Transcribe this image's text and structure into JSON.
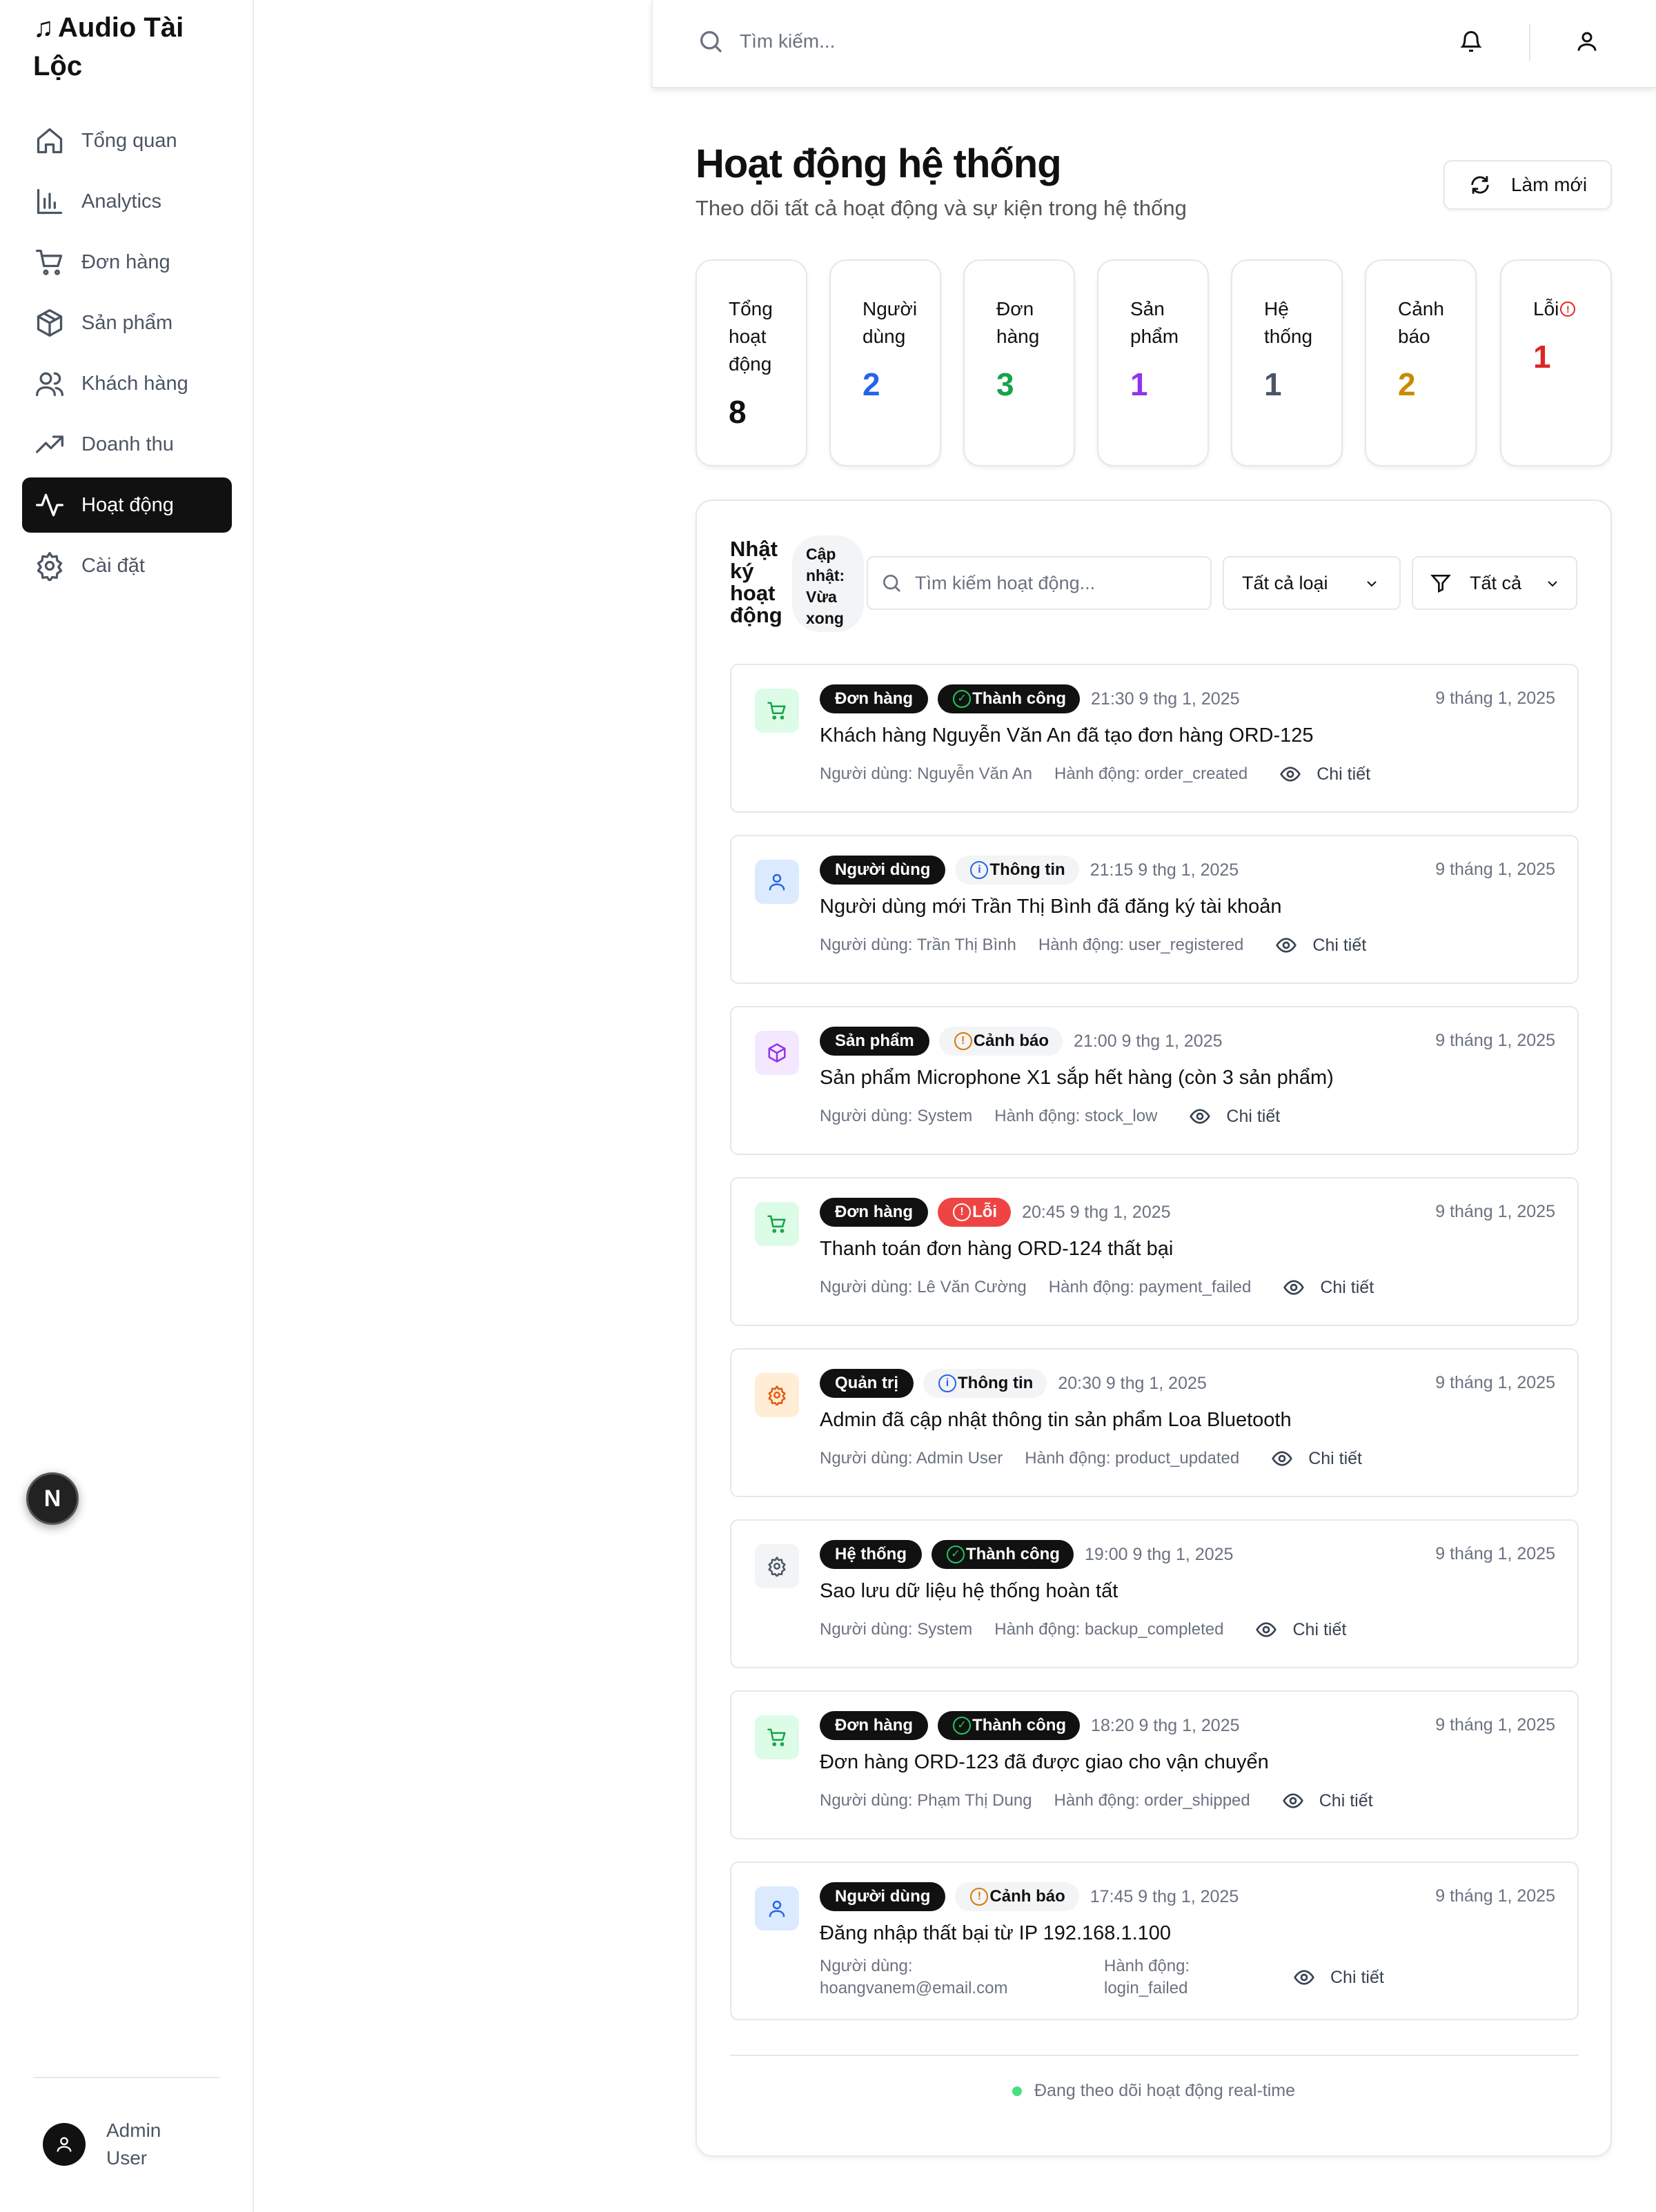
{
  "brand": {
    "title": "Audio Tài Lộc",
    "icon": "music-note-icon"
  },
  "sidebar": {
    "items": [
      {
        "label": "Tổng quan",
        "icon": "home-icon",
        "active": false
      },
      {
        "label": "Analytics",
        "icon": "bar-chart-icon",
        "active": false
      },
      {
        "label": "Đơn hàng",
        "icon": "cart-icon",
        "active": false
      },
      {
        "label": "Sản phẩm",
        "icon": "box-icon",
        "active": false
      },
      {
        "label": "Khách hàng",
        "icon": "users-icon",
        "active": false
      },
      {
        "label": "Doanh thu",
        "icon": "trending-up-icon",
        "active": false
      },
      {
        "label": "Hoạt động",
        "icon": "activity-icon",
        "active": true
      },
      {
        "label": "Cài đặt",
        "icon": "gear-icon",
        "active": false
      }
    ],
    "user": "Admin User",
    "badge": "N"
  },
  "topbar": {
    "search_placeholder": "Tìm kiếm..."
  },
  "header": {
    "title": "Hoạt động hệ thống",
    "subtitle": "Theo dõi tất cả hoạt động và sự kiện trong hệ thống",
    "refresh_label": "Làm mới"
  },
  "stats": [
    {
      "label": "Tổng hoạt động",
      "value": "8",
      "color": "#111111"
    },
    {
      "label": "Người dùng",
      "value": "2",
      "color": "#2563eb"
    },
    {
      "label": "Đơn hàng",
      "value": "3",
      "color": "#16a34a"
    },
    {
      "label": "Sản phẩm",
      "value": "1",
      "color": "#9333ea"
    },
    {
      "label": "Hệ thống",
      "value": "1",
      "color": "#4b5563"
    },
    {
      "label": "Cảnh báo",
      "value": "2",
      "color": "#ca8a04"
    },
    {
      "label": "Lỗi",
      "value": "1",
      "color": "#dc2626"
    }
  ],
  "log": {
    "title": "Nhật ký hoạt động",
    "update_status": "Cập nhật: Vừa xong",
    "search_placeholder": "Tìm kiếm hoạt động...",
    "type_filter": "Tất cả loại",
    "status_filter": "Tất cả",
    "detail_label": "Chi tiết",
    "live_text": "Đang theo dõi hoạt động real-time",
    "entries": [
      {
        "category": "Đơn hàng",
        "icon": "cart-icon",
        "status": "Thành công",
        "status_type": "success",
        "time": "21:30 9 thg 1, 2025",
        "date": "9 tháng 1, 2025",
        "message": "Khách hàng Nguyễn Văn An đã tạo đơn hàng ORD-125",
        "user": "Người dùng: Nguyễn Văn An",
        "action": "Hành động: order_created"
      },
      {
        "category": "Người dùng",
        "icon": "user-icon",
        "status": "Thông tin",
        "status_type": "info",
        "time": "21:15 9 thg 1, 2025",
        "date": "9 tháng 1, 2025",
        "message": "Người dùng mới Trần Thị Bình đã đăng ký tài khoản",
        "user": "Người dùng: Trần Thị Bình",
        "action": "Hành động: user_registered"
      },
      {
        "category": "Sản phẩm",
        "icon": "box-icon",
        "status": "Cảnh báo",
        "status_type": "warn",
        "time": "21:00 9 thg 1, 2025",
        "date": "9 tháng 1, 2025",
        "message": "Sản phẩm Microphone X1 sắp hết hàng (còn 3 sản phẩm)",
        "user": "Người dùng: System",
        "action": "Hành động: stock_low"
      },
      {
        "category": "Đơn hàng",
        "icon": "cart-icon",
        "status": "Lỗi",
        "status_type": "error",
        "time": "20:45 9 thg 1, 2025",
        "date": "9 tháng 1, 2025",
        "message": "Thanh toán đơn hàng ORD-124 thất bại",
        "user": "Người dùng: Lê Văn Cường",
        "action": "Hành động: payment_failed"
      },
      {
        "category": "Quản trị",
        "icon": "gear-icon",
        "status": "Thông tin",
        "status_type": "info",
        "time": "20:30 9 thg 1, 2025",
        "date": "9 tháng 1, 2025",
        "message": "Admin đã cập nhật thông tin sản phẩm Loa Bluetooth",
        "user": "Người dùng: Admin User",
        "action": "Hành động: product_updated"
      },
      {
        "category": "Hệ thống",
        "icon": "gear-icon",
        "status": "Thành công",
        "status_type": "success",
        "time": "19:00 9 thg 1, 2025",
        "date": "9 tháng 1, 2025",
        "message": "Sao lưu dữ liệu hệ thống hoàn tất",
        "user": "Người dùng: System",
        "action": "Hành động: backup_completed"
      },
      {
        "category": "Đơn hàng",
        "icon": "cart-icon",
        "status": "Thành công",
        "status_type": "success",
        "time": "18:20 9 thg 1, 2025",
        "date": "9 tháng 1, 2025",
        "message": "Đơn hàng ORD-123 đã được giao cho vận chuyển",
        "user": "Người dùng: Phạm Thị Dung",
        "action": "Hành động: order_shipped"
      },
      {
        "category": "Người dùng",
        "icon": "user-icon",
        "status": "Cảnh báo",
        "status_type": "warn",
        "time": "17:45 9 thg 1, 2025",
        "date": "9 tháng 1, 2025",
        "message": "Đăng nhập thất bại từ IP 192.168.1.100",
        "user": "Người dùng: hoangvanem@email.com",
        "action": "Hành động: login_failed"
      }
    ]
  }
}
